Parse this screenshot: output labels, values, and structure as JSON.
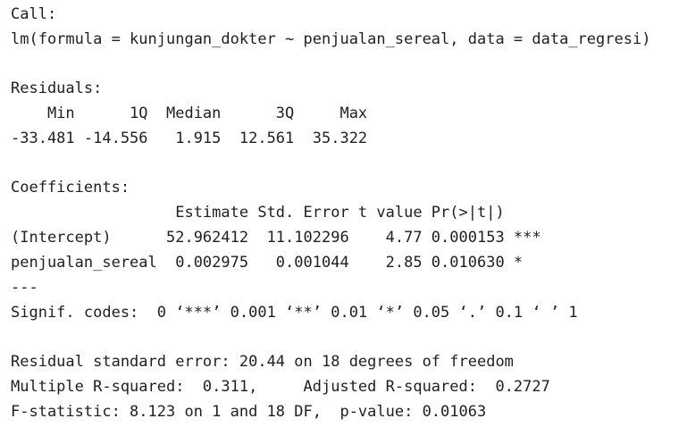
{
  "call": {
    "header": "Call:",
    "formula": "lm(formula = kunjungan_dokter ~ penjualan_sereal, data = data_regresi)"
  },
  "residuals": {
    "header": "Residuals:",
    "labels": "    Min      1Q  Median      3Q     Max ",
    "values": "-33.481 -14.556   1.915  12.561  35.322 "
  },
  "coefficients": {
    "header": "Coefficients:",
    "columns": "                  Estimate Std. Error t value Pr(>|t|)    ",
    "intercept_row": "(Intercept)      52.962412  11.102296    4.77 0.000153 ***",
    "sereal_row": "penjualan_sereal  0.002975   0.001044    2.85 0.010630 *  ",
    "separator": "---",
    "signif_codes": "Signif. codes:  0 ‘***’ 0.001 ‘**’ 0.01 ‘*’ 0.05 ‘.’ 0.1 ‘ ’ 1"
  },
  "summary": {
    "residual_se": "Residual standard error: 20.44 on 18 degrees of freedom",
    "r_squared": "Multiple R-squared:  0.311,\tAdjusted R-squared:  0.2727 ",
    "f_statistic": "F-statistic: 8.123 on 1 and 18 DF,  p-value: 0.01063"
  }
}
